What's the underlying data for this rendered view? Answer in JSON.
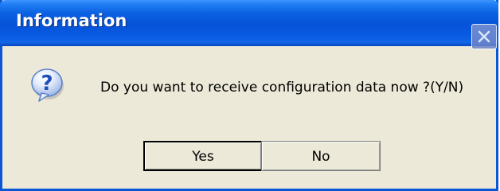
{
  "dialog": {
    "title": "Information",
    "message": "Do you want to receive configuration data now ?(Y/N)",
    "icon": "question-icon",
    "buttons": {
      "yes_label": "Yes",
      "no_label": "No"
    },
    "close_icon": "close-icon"
  },
  "colors": {
    "titlebar": "#0653d8",
    "dialog_background": "#ece9d8",
    "title_text": "#ffffff",
    "icon_blue": "#2e62c8"
  }
}
